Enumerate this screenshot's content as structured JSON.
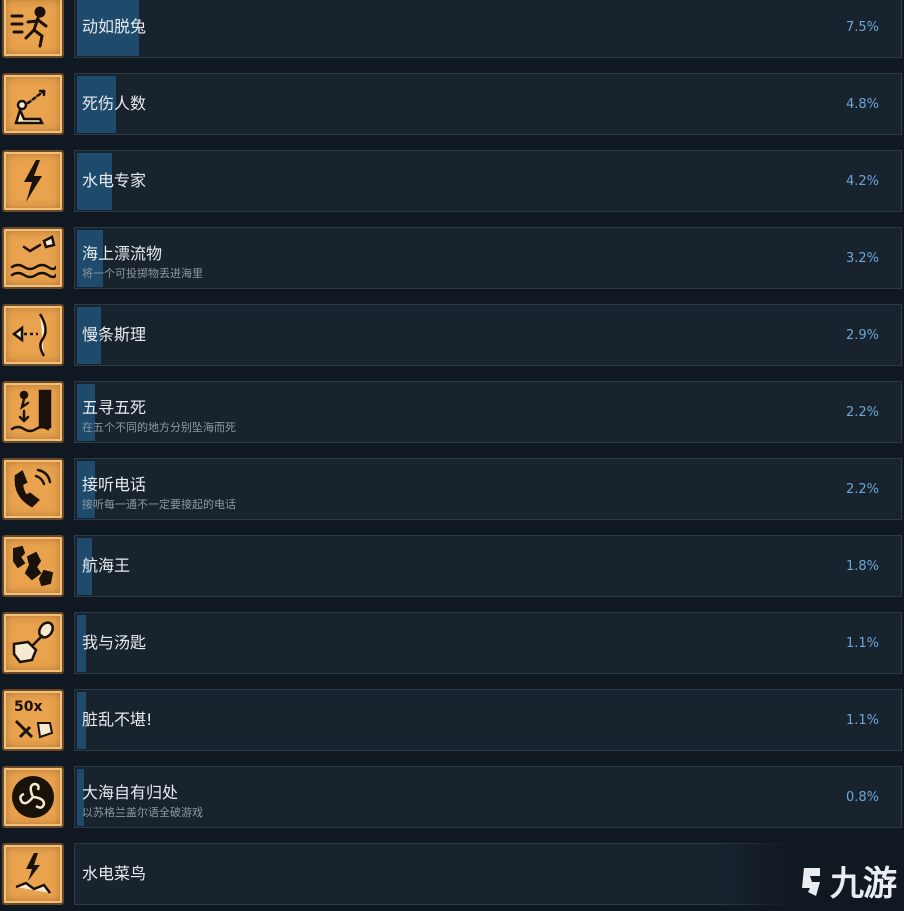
{
  "achievements": [
    {
      "title": "动如脱兔",
      "desc": "",
      "percent": "7.5%",
      "fill": 0.075,
      "icon": "running-man-icon"
    },
    {
      "title": "死伤人数",
      "desc": "",
      "percent": "4.8%",
      "fill": 0.048,
      "icon": "sitting-figure-icon"
    },
    {
      "title": "水电专家",
      "desc": "",
      "percent": "4.2%",
      "fill": 0.042,
      "icon": "lightning-bolt-icon"
    },
    {
      "title": "海上漂流物",
      "desc": "将一个可投掷物丢进海里",
      "percent": "3.2%",
      "fill": 0.032,
      "icon": "throw-into-sea-icon"
    },
    {
      "title": "慢条斯理",
      "desc": "",
      "percent": "2.9%",
      "fill": 0.029,
      "icon": "slow-arrow-icon"
    },
    {
      "title": "五寻五死",
      "desc": "在五个不同的地方分别坠海而死",
      "percent": "2.2%",
      "fill": 0.022,
      "icon": "falling-figure-icon"
    },
    {
      "title": "接听电话",
      "desc": "接听每一通不一定要接起的电话",
      "percent": "2.2%",
      "fill": 0.022,
      "icon": "phone-handset-icon"
    },
    {
      "title": "航海王",
      "desc": "",
      "percent": "1.8%",
      "fill": 0.018,
      "icon": "map-icon"
    },
    {
      "title": "我与汤匙",
      "desc": "",
      "percent": "1.1%",
      "fill": 0.011,
      "icon": "hand-spoon-icon"
    },
    {
      "title": "脏乱不堪!",
      "desc": "",
      "percent": "1.1%",
      "fill": 0.011,
      "icon": "50x-tools-icon",
      "icon_text": "50x"
    },
    {
      "title": "大海自有归处",
      "desc": "以苏格兰盖尔语全破游戏",
      "percent": "0.8%",
      "fill": 0.008,
      "icon": "triskelion-icon"
    },
    {
      "title": "水电菜鸟",
      "desc": "",
      "percent": "",
      "fill": 0.0,
      "icon": "lightning-falling-icon"
    }
  ],
  "watermark": {
    "text": "九游"
  }
}
